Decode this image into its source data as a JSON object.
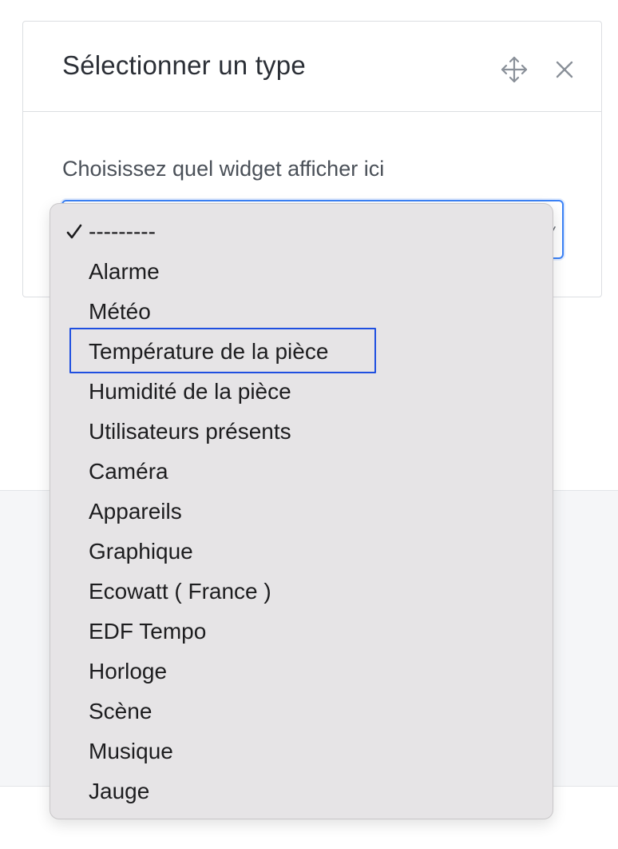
{
  "dialog": {
    "title": "Sélectionner un type",
    "field_label": "Choisissez quel widget afficher ici",
    "selected_value": "---------",
    "accent_color": "#3b82f6"
  },
  "dropdown": {
    "options": [
      "---------",
      "Alarme",
      "Météo",
      "Température de la pièce",
      "Humidité de la pièce",
      "Utilisateurs présents",
      "Caméra",
      "Appareils",
      "Graphique",
      "Ecowatt ( France )",
      "EDF Tempo",
      "Horloge",
      "Scène",
      "Musique",
      "Jauge"
    ],
    "checked_option": "---------",
    "focused_option": "Température de la pièce"
  },
  "icons": {
    "move": "move-icon",
    "close": "close-icon",
    "check": "checkmark-icon",
    "chevron": "chevron-down-icon"
  }
}
